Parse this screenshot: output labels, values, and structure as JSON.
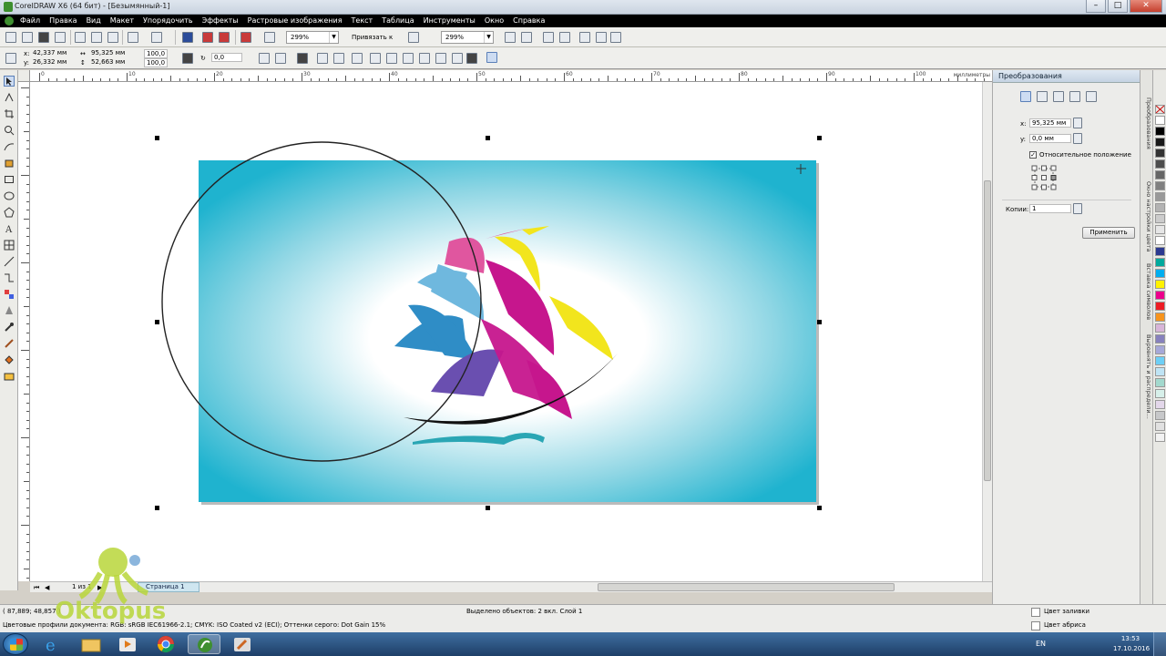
{
  "window": {
    "title": "CorelDRAW X6 (64 бит) - [Безымянный-1]"
  },
  "menu": [
    "Файл",
    "Правка",
    "Вид",
    "Макет",
    "Упорядочить",
    "Эффекты",
    "Растровые изображения",
    "Текст",
    "Таблица",
    "Инструменты",
    "Окно",
    "Справка"
  ],
  "toolbar": {
    "zoom_value": "299%",
    "snap_label": "Привязать к",
    "zoom_value_2": "299%"
  },
  "properties": {
    "x": "42,337 мм",
    "y": "26,332 мм",
    "width": "95,325 мм",
    "height": "52,663 мм",
    "scale_x": "100,0",
    "scale_y": "100,0",
    "rotation": "0,0",
    "x_label": "x:",
    "y_label": "y:"
  },
  "ruler": {
    "units": "миллиметры",
    "numbers": [
      "0",
      "10",
      "20",
      "30",
      "40",
      "50",
      "60",
      "70",
      "80",
      "90",
      "100"
    ]
  },
  "pagebar": {
    "page_info": "1 из 1",
    "page_tab": "Страница 1"
  },
  "docker": {
    "title": "Преобразования",
    "x_label": "x:",
    "x_value": "95,325 мм",
    "y_label": "y:",
    "y_value": "0,0 мм",
    "relative_label": "Относительное положение",
    "relative_checked": true,
    "copies_label": "Копии:",
    "copies_value": "1",
    "apply_label": "Применить"
  },
  "docker_tabs": [
    "Преобразования",
    "Окно настройки цвета",
    "Вставка символов",
    "Выровнять и распредели..."
  ],
  "palette": [
    "#ffffff",
    "#000000",
    "#1a1a1a",
    "#333333",
    "#4d4d4d",
    "#666666",
    "#808080",
    "#999999",
    "#b3b3b3",
    "#cccccc",
    "#e6e6e6",
    "#ffffff",
    "#2b3990",
    "#00a99d",
    "#00aeef",
    "#fff200",
    "#ec008c",
    "#ed1c24",
    "#f7941d",
    "#d7b5d8",
    "#8781bd",
    "#a6a8d8",
    "#6dcff6",
    "#bfe4f5",
    "#a3d9ce",
    "#d7f0ea",
    "#e3d7ea",
    "#c7c8ca",
    "#e1e1e1",
    "#f2f2f2"
  ],
  "status": {
    "cursor": "( 87,889; 48,857 )",
    "selected": "Выделено объектов: 2 вкл. Слой 1",
    "profile": "Цветовые профили документа: RGB: sRGB IEC61966-2.1; CMYK: ISO Coated v2 (ECI); Оттенки серого: Dot Gain 15%",
    "fill": "Цвет заливки",
    "stroke": "Цвет абриса"
  },
  "taskbar": {
    "lang": "EN",
    "time": "13:53",
    "date": "17.10.2016"
  },
  "watermark": "Oktopus",
  "artwork": {
    "sails": {
      "pink": "#e0569f",
      "magenta": "#c6168d",
      "yellow": "#f2e51d",
      "blue": "#2f8dc6",
      "light_blue": "#6fb8de",
      "purple": "#6a4fb0",
      "teal": "#2aa6b4"
    },
    "background_edge": "#1fb3cf"
  }
}
